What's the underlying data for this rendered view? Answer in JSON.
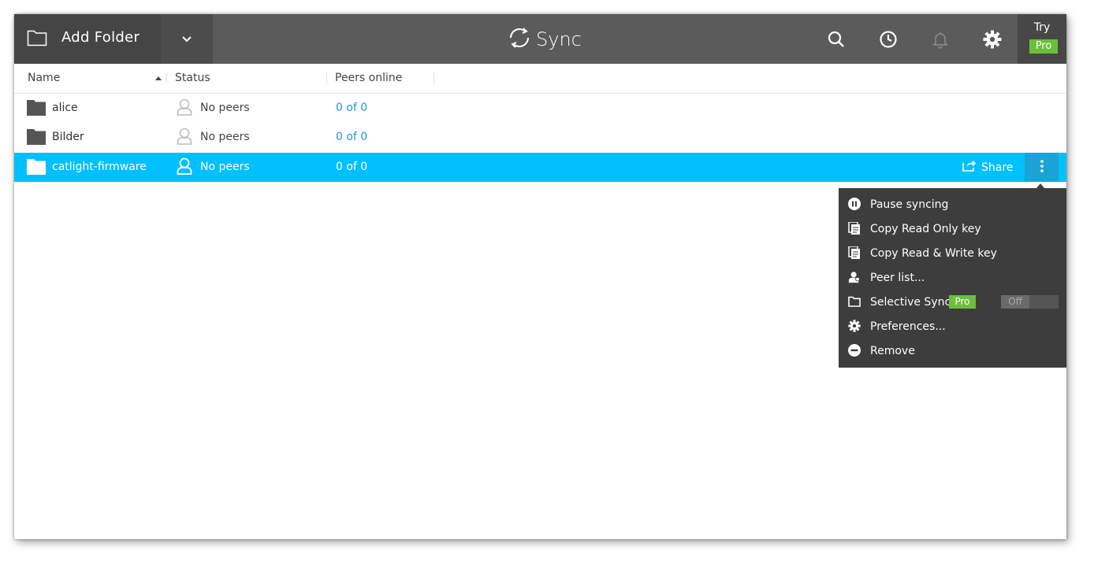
{
  "toolbar": {
    "add_folder_label": "Add Folder",
    "logo_text": "Sync",
    "try_label": "Try",
    "pro_label": "Pro",
    "icons": [
      "search-icon",
      "history-icon",
      "bell-icon",
      "gear-icon"
    ]
  },
  "columns": {
    "name": "Name",
    "status": "Status",
    "peers_online": "Peers online",
    "sort": "ascending"
  },
  "folders": [
    {
      "name": "alice",
      "status": "No peers",
      "peers": "0 of 0",
      "selected": false
    },
    {
      "name": "Bilder",
      "status": "No peers",
      "peers": "0 of 0",
      "selected": false
    },
    {
      "name": "catlight-firmware",
      "status": "No peers",
      "peers": "0 of 0",
      "selected": true
    }
  ],
  "row_actions": {
    "share_label": "Share"
  },
  "context_menu": {
    "items": [
      {
        "label": "Pause syncing",
        "icon": "pause-icon"
      },
      {
        "label": "Copy Read Only key",
        "icon": "copy-icon"
      },
      {
        "label": "Copy Read & Write key",
        "icon": "copy-icon"
      },
      {
        "label": "Peer list...",
        "icon": "peers-icon"
      },
      {
        "label": "Selective Sync",
        "icon": "folder-outline-icon",
        "badge": "Pro",
        "toggle": "Off"
      },
      {
        "label": "Preferences...",
        "icon": "gear-icon"
      },
      {
        "label": "Remove",
        "icon": "remove-icon"
      }
    ]
  },
  "colors": {
    "accent": "#00c0ff",
    "toolbar": "#5b5b5b",
    "pro_green": "#6cbf3b",
    "link_blue": "#1a9bd7",
    "menu_bg": "#3d3d3d"
  }
}
